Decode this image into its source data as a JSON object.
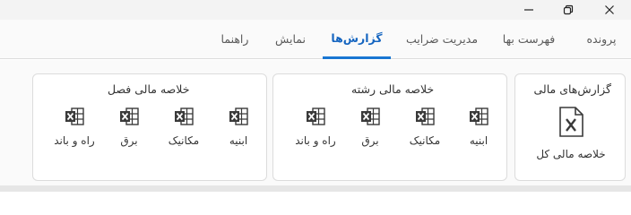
{
  "window": {
    "minimize_icon": "minimize-icon",
    "maximize_icon": "restore-icon",
    "close_icon": "close-icon"
  },
  "tabs": [
    {
      "label": "پرونده"
    },
    {
      "label": "فهرست بها"
    },
    {
      "label": "مدیریت ضرایب"
    },
    {
      "label": "گزارش‌ها"
    },
    {
      "label": "نمایش"
    },
    {
      "label": "راهنما"
    }
  ],
  "active_tab": "گزارش‌ها",
  "groups": {
    "reports": {
      "title": "گزارش‌های مالی",
      "items": [
        {
          "label": "خلاصه مالی کل",
          "icon": "pdf-document-icon"
        }
      ]
    },
    "discipline": {
      "title": "خلاصه مالی رشته",
      "items": [
        {
          "label": "ابنیه",
          "icon": "excel-icon"
        },
        {
          "label": "مکانیک",
          "icon": "excel-icon"
        },
        {
          "label": "برق",
          "icon": "excel-icon"
        },
        {
          "label": "راه و باند",
          "icon": "excel-icon"
        }
      ]
    },
    "chapter": {
      "title": "خلاصه مالی فصل",
      "items": [
        {
          "label": "ابنیه",
          "icon": "excel-icon"
        },
        {
          "label": "مکانیک",
          "icon": "excel-icon"
        },
        {
          "label": "برق",
          "icon": "excel-icon"
        },
        {
          "label": "راه و باند",
          "icon": "excel-icon"
        }
      ]
    }
  },
  "colors": {
    "accent": "#1976d2",
    "excel_icon": "#3a3a3a"
  }
}
